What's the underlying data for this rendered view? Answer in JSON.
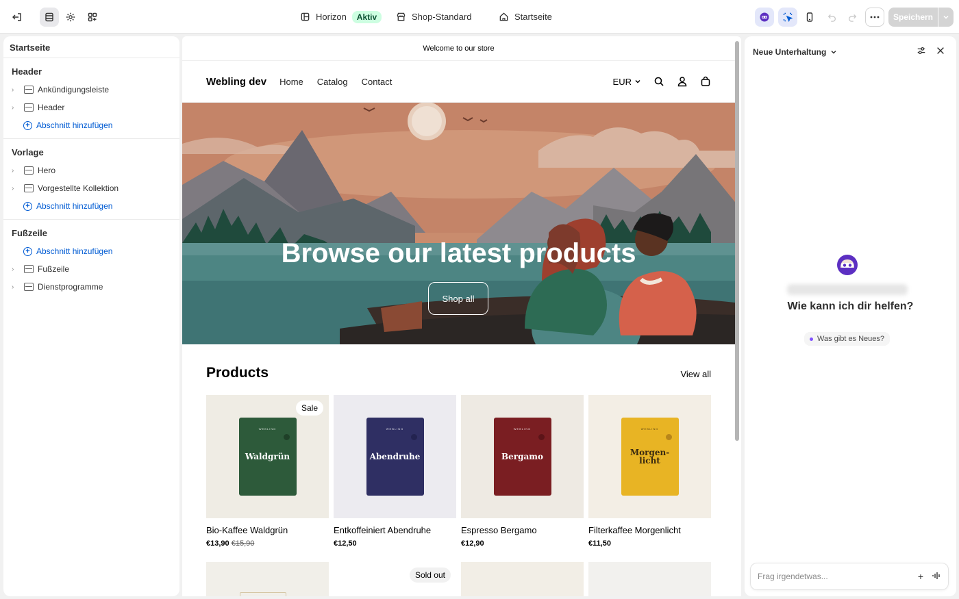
{
  "topbar": {
    "theme_name": "Horizon",
    "theme_badge": "Aktiv",
    "store_context": "Shop-Standard",
    "page_context": "Startseite",
    "save_label": "Speichern"
  },
  "sidebar": {
    "title": "Startseite",
    "groups": [
      {
        "title": "Header",
        "items": [
          "Ankündigungsleiste",
          "Header"
        ],
        "add_label": "Abschnitt hinzufügen"
      },
      {
        "title": "Vorlage",
        "items": [
          "Hero",
          "Vorgestellte Kollektion"
        ],
        "add_label": "Abschnitt hinzufügen"
      },
      {
        "title": "Fußzeile",
        "add_label": "Abschnitt hinzufügen",
        "items": [
          "Fußzeile",
          "Dienstprogramme"
        ]
      }
    ]
  },
  "store": {
    "announcement": "Welcome to our store",
    "brand": "Webling dev",
    "nav": [
      "Home",
      "Catalog",
      "Contact"
    ],
    "currency": "EUR",
    "hero_title": "Browse our latest products",
    "hero_button": "Shop all",
    "products_title": "Products",
    "view_all": "View all",
    "products": [
      {
        "bag_name": "Waldgrün",
        "name": "Bio-Kaffee Waldgrün",
        "price": "€13,90",
        "old_price": "€15,90",
        "tag": "Sale"
      },
      {
        "bag_name": "Abendruhe",
        "name": "Entkoffeiniert Abendruhe",
        "price": "€12,50"
      },
      {
        "bag_name": "Bergamo",
        "name": "Espresso Bergamo",
        "price": "€12,90"
      },
      {
        "bag_name": "Morgen-licht",
        "name": "Filterkaffee Morgenlicht",
        "price": "€11,50"
      }
    ],
    "sold_out_tag": "Sold out"
  },
  "chat": {
    "title": "Neue Unterhaltung",
    "help_text": "Wie kann ich dir helfen?",
    "suggestion": "Was gibt es Neues?",
    "input_placeholder": "Frag irgendetwas..."
  },
  "colors": {
    "accent_blue": "#005bd3",
    "badge_green": "#cdfee1",
    "bag_green": "#2d5a3a",
    "bag_navy": "#2f2f63",
    "bag_red": "#7a1e22",
    "bag_yellow": "#e8b424"
  }
}
